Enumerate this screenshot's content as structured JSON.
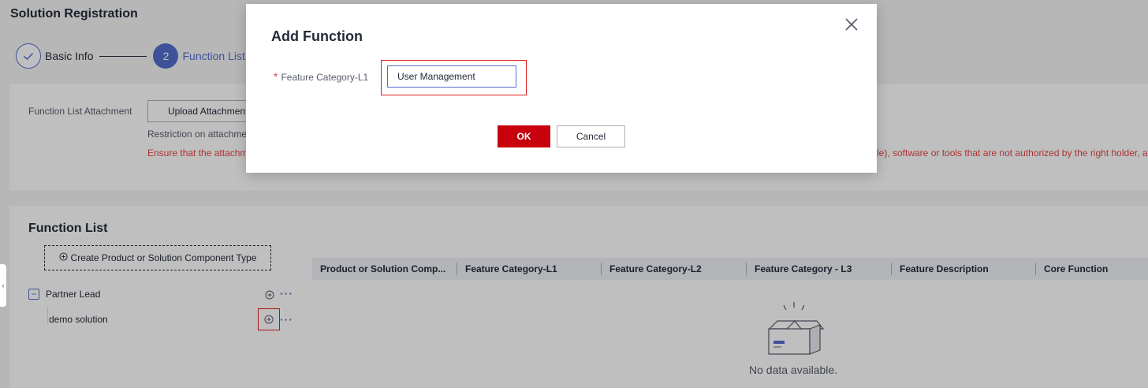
{
  "page": {
    "title": "Solution Registration"
  },
  "stepper": {
    "steps": [
      {
        "number": "",
        "label": "Basic Info",
        "state": "done"
      },
      {
        "number": "2",
        "label": "Function List",
        "state": "active"
      }
    ]
  },
  "attachment": {
    "label": "Function List Attachment",
    "upload_button": "Upload Attachment",
    "restriction": "Restriction on attachme",
    "warning_left": "Ensure that the attachm",
    "warning_right": "le), software or tools that are not authorized by the right holder, a"
  },
  "function_list": {
    "title": "Function List",
    "create_button": "Create Product or Solution Component Type",
    "tree": [
      {
        "label": "Partner Lead",
        "expanded": true
      },
      {
        "label": "demo solution"
      }
    ],
    "table_columns": [
      "Product or Solution Comp...",
      "Feature Category-L1",
      "Feature Category-L2",
      "Feature Category - L3",
      "Feature Description",
      "Core Function"
    ],
    "empty_text": "No data available."
  },
  "modal": {
    "title": "Add Function",
    "field_label": "Feature Category-L1",
    "required_mark": "*",
    "field_value": "User Management",
    "ok_label": "OK",
    "cancel_label": "Cancel"
  },
  "colors": {
    "primary": "#526ecc",
    "danger": "#c7000b",
    "warning_text": "#e54545",
    "highlight": "#e01e1e"
  }
}
